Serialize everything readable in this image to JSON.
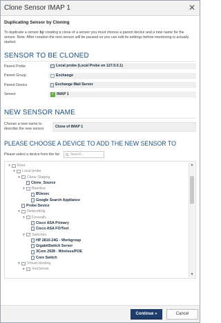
{
  "window": {
    "title": "Clone Sensor IMAP 1",
    "close_icon": "✕"
  },
  "subtitle": "Duplicating Sensor by Cloning",
  "intro": {
    "prefix": "To duplicate a sensor ",
    "bold": "by",
    "suffix": " creating a clone of a sensor you must choose a parent device and a new name for the sensor. Note: After creation the new sensor will be paused so you can edit its settings before monitoring is actually started."
  },
  "sensor_to_clone": {
    "heading": "SENSOR TO BE CLONED",
    "rows": [
      {
        "label": "Parent Probe",
        "value": "Local probe (Local Probe on 127.0.0.1)",
        "icon": "probe-icon"
      },
      {
        "label": "Parent Group",
        "value": "Exchange",
        "icon": "folder-icon"
      },
      {
        "label": "Parent Device",
        "value": "Exchange Mail Server",
        "icon": "device-icon"
      },
      {
        "label": "Sensor",
        "value": "IMAP 1",
        "icon": "check-icon"
      }
    ]
  },
  "new_sensor": {
    "heading": "NEW SENSOR NAME",
    "label": "Choose a new name to describe the new sensor",
    "value": "Clone of IMAP 1"
  },
  "device_picker": {
    "heading": "PLEASE CHOOSE A DEVICE TO ADD THE NEW SENSOR TO",
    "instruction": "Please select a device from the list",
    "search_placeholder": "Search...",
    "tree": [
      {
        "label": "Root",
        "depth": 0,
        "kind": "group",
        "toggle": "▾"
      },
      {
        "label": "Local probe",
        "depth": 1,
        "kind": "group",
        "toggle": "▾"
      },
      {
        "label": "Clone Staging",
        "depth": 2,
        "kind": "group",
        "toggle": "▾"
      },
      {
        "label": "Clone_Source",
        "depth": 3,
        "kind": "device",
        "toggle": ""
      },
      {
        "label": "Baseline",
        "depth": 3,
        "kind": "group",
        "toggle": "▾"
      },
      {
        "label": "BUexec",
        "depth": 4,
        "kind": "device",
        "toggle": ""
      },
      {
        "label": "Google Search Appliance",
        "depth": 4,
        "kind": "device",
        "toggle": ""
      },
      {
        "label": "Probe Device",
        "depth": 2,
        "kind": "device",
        "toggle": ""
      },
      {
        "label": "Networking",
        "depth": 2,
        "kind": "group",
        "toggle": "▾"
      },
      {
        "label": "Firewalls",
        "depth": 3,
        "kind": "group",
        "toggle": "▾"
      },
      {
        "label": "Cisco ASA Primary",
        "depth": 4,
        "kind": "device",
        "toggle": ""
      },
      {
        "label": "Cisco ASA FO/Test",
        "depth": 4,
        "kind": "device",
        "toggle": ""
      },
      {
        "label": "Switches",
        "depth": 3,
        "kind": "group",
        "toggle": "▾"
      },
      {
        "label": "HP 2810-24G - Workgroup",
        "depth": 4,
        "kind": "device",
        "toggle": ""
      },
      {
        "label": "GigabitSwitch Server",
        "depth": 4,
        "kind": "device",
        "toggle": ""
      },
      {
        "label": "3Com 2928 - Wireless/POE",
        "depth": 4,
        "kind": "device",
        "toggle": ""
      },
      {
        "label": "Core Switch",
        "depth": 4,
        "kind": "device",
        "toggle": ""
      },
      {
        "label": "Virtual Hosting",
        "depth": 2,
        "kind": "group",
        "toggle": "▾"
      },
      {
        "label": "XenServer",
        "depth": 3,
        "kind": "group",
        "toggle": "▸"
      }
    ]
  },
  "footer": {
    "continue_label": "Continue »",
    "cancel_label": "Cancel"
  },
  "colors": {
    "heading": "#1d4f7a",
    "primary_button": "#1f3d6a",
    "check": "#6aa84f"
  }
}
